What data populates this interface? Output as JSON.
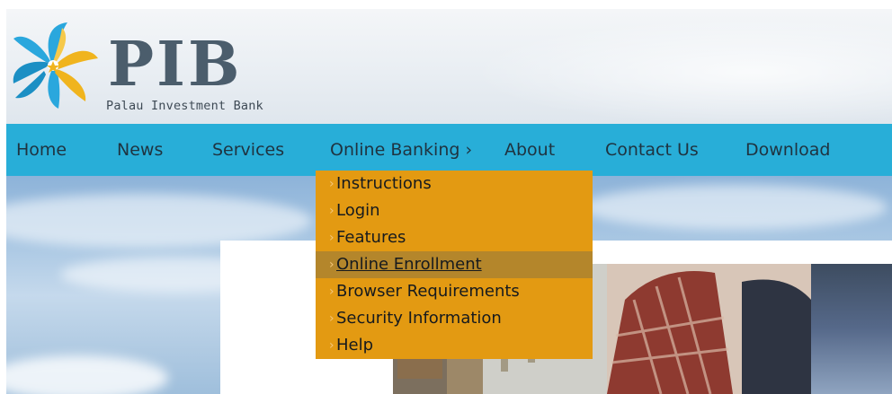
{
  "header": {
    "logo_text": "PIB",
    "logo_subtitle": "Palau Investment Bank",
    "brand_colors": {
      "blue": "#2aa7dd",
      "gold": "#f0b41e",
      "text": "#4b5d6c"
    }
  },
  "nav": {
    "items": [
      {
        "label": "Home"
      },
      {
        "label": "News"
      },
      {
        "label": "Services"
      },
      {
        "label": "Online Banking ›"
      },
      {
        "label": "About"
      },
      {
        "label": "Contact Us"
      },
      {
        "label": "Download"
      }
    ],
    "background": "#28aed8"
  },
  "dropdown": {
    "parent": "Online Banking",
    "arrow_glyph": "›",
    "background": "#e39a12",
    "highlight": "#b4862b",
    "items": [
      {
        "label": "Instructions"
      },
      {
        "label": "Login"
      },
      {
        "label": "Features"
      },
      {
        "label": "Online Enrollment"
      },
      {
        "label": "Browser Requirements"
      },
      {
        "label": "Security Information"
      },
      {
        "label": "Help"
      }
    ],
    "active_item": "Online Enrollment"
  }
}
